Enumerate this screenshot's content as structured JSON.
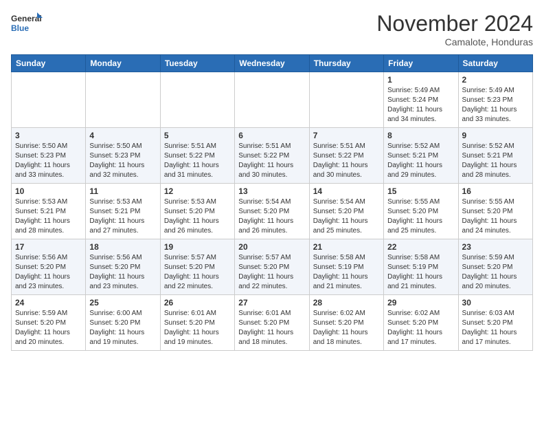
{
  "header": {
    "logo_line1": "General",
    "logo_line2": "Blue",
    "month": "November 2024",
    "location": "Camalote, Honduras"
  },
  "days_of_week": [
    "Sunday",
    "Monday",
    "Tuesday",
    "Wednesday",
    "Thursday",
    "Friday",
    "Saturday"
  ],
  "weeks": [
    [
      {
        "day": "",
        "info": ""
      },
      {
        "day": "",
        "info": ""
      },
      {
        "day": "",
        "info": ""
      },
      {
        "day": "",
        "info": ""
      },
      {
        "day": "",
        "info": ""
      },
      {
        "day": "1",
        "info": "Sunrise: 5:49 AM\nSunset: 5:24 PM\nDaylight: 11 hours and 34 minutes."
      },
      {
        "day": "2",
        "info": "Sunrise: 5:49 AM\nSunset: 5:23 PM\nDaylight: 11 hours and 33 minutes."
      }
    ],
    [
      {
        "day": "3",
        "info": "Sunrise: 5:50 AM\nSunset: 5:23 PM\nDaylight: 11 hours and 33 minutes."
      },
      {
        "day": "4",
        "info": "Sunrise: 5:50 AM\nSunset: 5:23 PM\nDaylight: 11 hours and 32 minutes."
      },
      {
        "day": "5",
        "info": "Sunrise: 5:51 AM\nSunset: 5:22 PM\nDaylight: 11 hours and 31 minutes."
      },
      {
        "day": "6",
        "info": "Sunrise: 5:51 AM\nSunset: 5:22 PM\nDaylight: 11 hours and 30 minutes."
      },
      {
        "day": "7",
        "info": "Sunrise: 5:51 AM\nSunset: 5:22 PM\nDaylight: 11 hours and 30 minutes."
      },
      {
        "day": "8",
        "info": "Sunrise: 5:52 AM\nSunset: 5:21 PM\nDaylight: 11 hours and 29 minutes."
      },
      {
        "day": "9",
        "info": "Sunrise: 5:52 AM\nSunset: 5:21 PM\nDaylight: 11 hours and 28 minutes."
      }
    ],
    [
      {
        "day": "10",
        "info": "Sunrise: 5:53 AM\nSunset: 5:21 PM\nDaylight: 11 hours and 28 minutes."
      },
      {
        "day": "11",
        "info": "Sunrise: 5:53 AM\nSunset: 5:21 PM\nDaylight: 11 hours and 27 minutes."
      },
      {
        "day": "12",
        "info": "Sunrise: 5:53 AM\nSunset: 5:20 PM\nDaylight: 11 hours and 26 minutes."
      },
      {
        "day": "13",
        "info": "Sunrise: 5:54 AM\nSunset: 5:20 PM\nDaylight: 11 hours and 26 minutes."
      },
      {
        "day": "14",
        "info": "Sunrise: 5:54 AM\nSunset: 5:20 PM\nDaylight: 11 hours and 25 minutes."
      },
      {
        "day": "15",
        "info": "Sunrise: 5:55 AM\nSunset: 5:20 PM\nDaylight: 11 hours and 25 minutes."
      },
      {
        "day": "16",
        "info": "Sunrise: 5:55 AM\nSunset: 5:20 PM\nDaylight: 11 hours and 24 minutes."
      }
    ],
    [
      {
        "day": "17",
        "info": "Sunrise: 5:56 AM\nSunset: 5:20 PM\nDaylight: 11 hours and 23 minutes."
      },
      {
        "day": "18",
        "info": "Sunrise: 5:56 AM\nSunset: 5:20 PM\nDaylight: 11 hours and 23 minutes."
      },
      {
        "day": "19",
        "info": "Sunrise: 5:57 AM\nSunset: 5:20 PM\nDaylight: 11 hours and 22 minutes."
      },
      {
        "day": "20",
        "info": "Sunrise: 5:57 AM\nSunset: 5:20 PM\nDaylight: 11 hours and 22 minutes."
      },
      {
        "day": "21",
        "info": "Sunrise: 5:58 AM\nSunset: 5:19 PM\nDaylight: 11 hours and 21 minutes."
      },
      {
        "day": "22",
        "info": "Sunrise: 5:58 AM\nSunset: 5:19 PM\nDaylight: 11 hours and 21 minutes."
      },
      {
        "day": "23",
        "info": "Sunrise: 5:59 AM\nSunset: 5:20 PM\nDaylight: 11 hours and 20 minutes."
      }
    ],
    [
      {
        "day": "24",
        "info": "Sunrise: 5:59 AM\nSunset: 5:20 PM\nDaylight: 11 hours and 20 minutes."
      },
      {
        "day": "25",
        "info": "Sunrise: 6:00 AM\nSunset: 5:20 PM\nDaylight: 11 hours and 19 minutes."
      },
      {
        "day": "26",
        "info": "Sunrise: 6:01 AM\nSunset: 5:20 PM\nDaylight: 11 hours and 19 minutes."
      },
      {
        "day": "27",
        "info": "Sunrise: 6:01 AM\nSunset: 5:20 PM\nDaylight: 11 hours and 18 minutes."
      },
      {
        "day": "28",
        "info": "Sunrise: 6:02 AM\nSunset: 5:20 PM\nDaylight: 11 hours and 18 minutes."
      },
      {
        "day": "29",
        "info": "Sunrise: 6:02 AM\nSunset: 5:20 PM\nDaylight: 11 hours and 17 minutes."
      },
      {
        "day": "30",
        "info": "Sunrise: 6:03 AM\nSunset: 5:20 PM\nDaylight: 11 hours and 17 minutes."
      }
    ]
  ]
}
